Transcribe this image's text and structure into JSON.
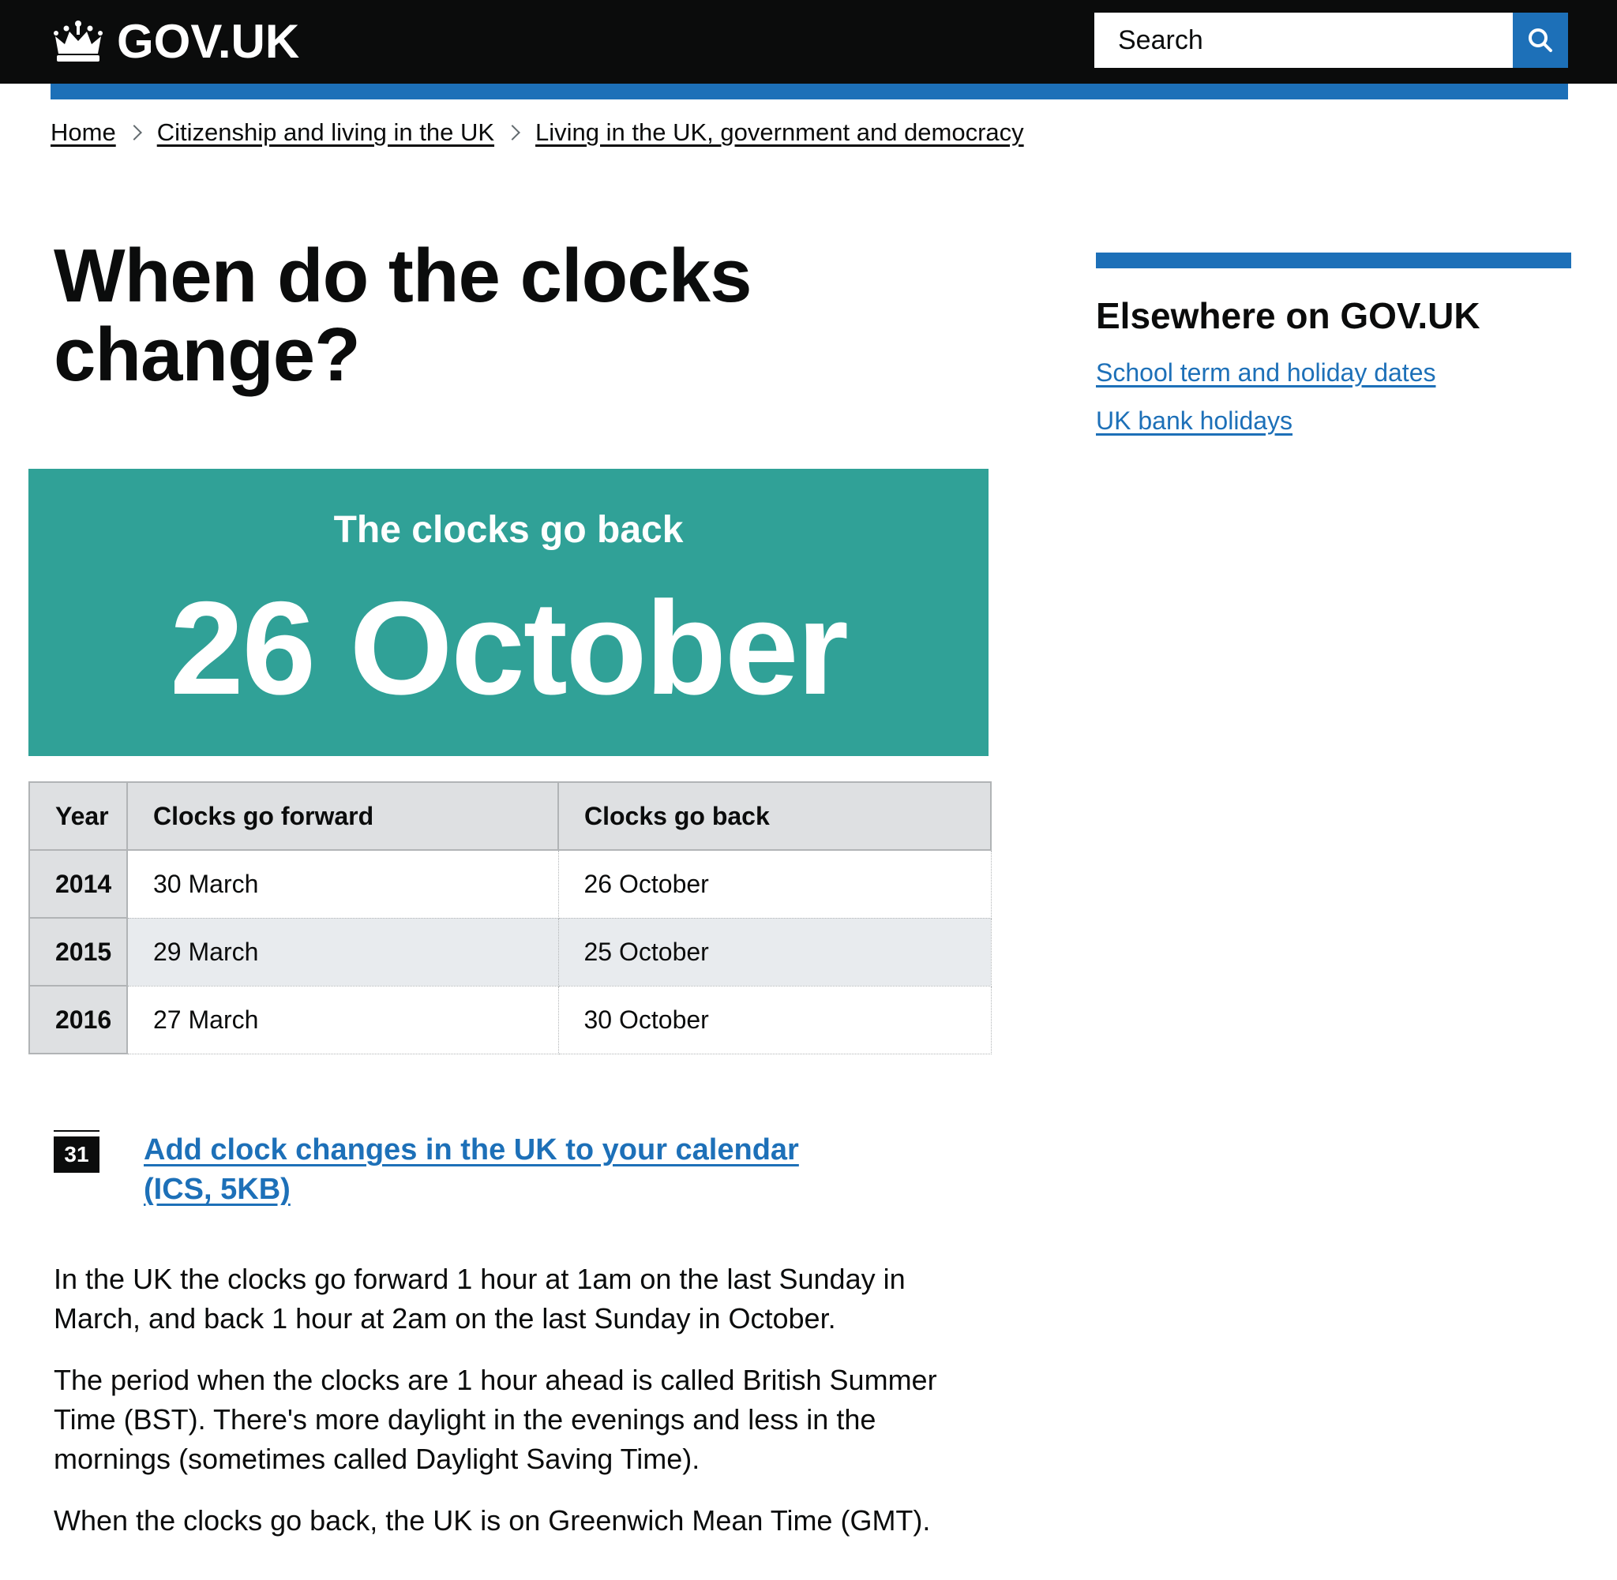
{
  "header": {
    "logo_text": "GOV.UK",
    "search_placeholder": "Search",
    "accent": "#1d70b8"
  },
  "breadcrumbs": [
    {
      "label": "Home"
    },
    {
      "label": "Citizenship and living in the UK"
    },
    {
      "label": "Living in the UK, government and democracy"
    }
  ],
  "title": "When do the clocks change?",
  "panel": {
    "subtitle": "The clocks go back",
    "date": "26 October",
    "color": "#30a197"
  },
  "table": {
    "headers": [
      "Year",
      "Clocks go forward",
      "Clocks go back"
    ],
    "rows": [
      {
        "year": "2014",
        "forward": "30 March",
        "back": "26 October"
      },
      {
        "year": "2015",
        "forward": "29 March",
        "back": "25 October"
      },
      {
        "year": "2016",
        "forward": "27 March",
        "back": "30 October"
      }
    ]
  },
  "calendar": {
    "icon_label": "31",
    "link_text": "Add clock changes in the UK to your calendar (ICS, 5KB)"
  },
  "body": {
    "paragraphs": [
      "In the UK the clocks go forward 1 hour at 1am on the last Sunday in March, and back 1 hour at 2am on the last Sunday in October.",
      "The period when the clocks are 1 hour ahead is called British Summer Time (BST). There's more daylight in the evenings and less in the mornings (sometimes called Daylight Saving Time).",
      "When the clocks go back, the UK is on Greenwich Mean Time (GMT)."
    ]
  },
  "sidebar": {
    "title": "Elsewhere on GOV.UK",
    "links": [
      {
        "label": "School term and holiday dates"
      },
      {
        "label": "UK bank holidays"
      }
    ]
  },
  "icons": {
    "logo": "crown-icon",
    "search": "search-icon",
    "breadcrumb_separator": "chevron-right-icon",
    "calendar": "calendar-icon"
  }
}
